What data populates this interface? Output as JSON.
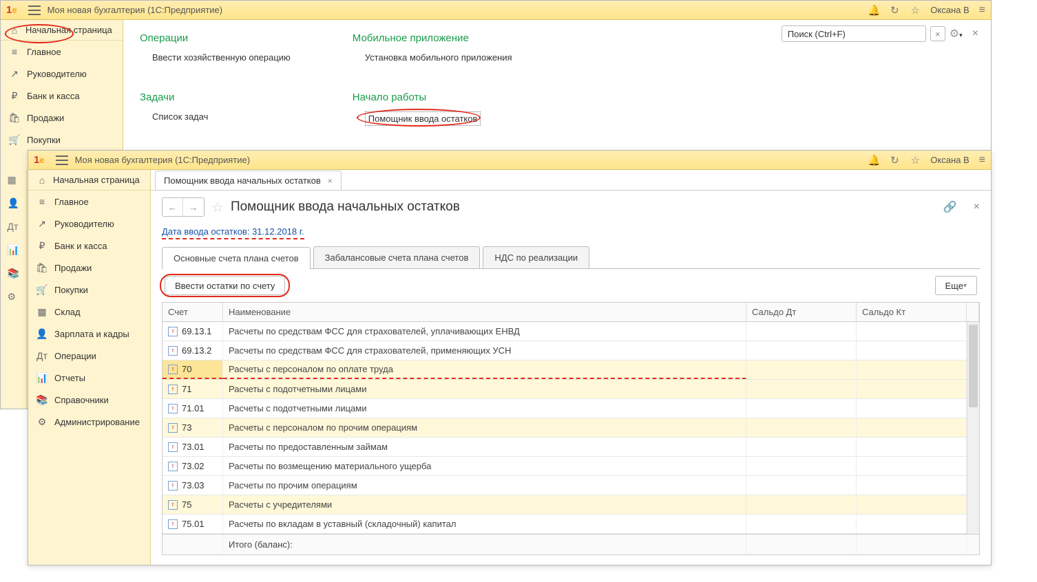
{
  "app_title": "Моя новая бухгалтерия  (1С:Предприятие)",
  "user": "Оксана В",
  "home_label": "Начальная страница",
  "sidebar": [
    {
      "icon": "≡",
      "label": "Главное"
    },
    {
      "icon": "↗",
      "label": "Руководителю"
    },
    {
      "icon": "₽",
      "label": "Банк и касса"
    },
    {
      "icon": "🛍",
      "label": "Продажи"
    },
    {
      "icon": "🛒",
      "label": "Покупки"
    },
    {
      "icon": "▦",
      "label": "Склад"
    },
    {
      "icon": "👤",
      "label": "Зарплата и кадры"
    },
    {
      "icon": "Дт",
      "label": "Операции"
    },
    {
      "icon": "📊",
      "label": "Отчеты"
    },
    {
      "icon": "📚",
      "label": "Справочники"
    },
    {
      "icon": "⚙",
      "label": "Администрирование"
    }
  ],
  "narrow_icons": [
    "▦",
    "👤",
    "Дт",
    "📊",
    "📚",
    "⚙"
  ],
  "sections": {
    "ops": {
      "title": "Операции",
      "link": "Ввести хозяйственную операцию"
    },
    "tasks": {
      "title": "Задачи",
      "link": "Список задач"
    },
    "mobile": {
      "title": "Мобильное приложение",
      "link": "Установка мобильного приложения"
    },
    "start": {
      "title": "Начало работы",
      "link": "Помощник ввода остатков"
    }
  },
  "search_placeholder": "Поиск (Ctrl+F)",
  "win2": {
    "tab_label": "Помощник ввода начальных остатков",
    "page_title": "Помощник ввода начальных остатков",
    "date_link": "Дата ввода остатков: 31.12.2018 г.",
    "subtabs": [
      "Основные счета плана счетов",
      "Забалансовые счета плана счетов",
      "НДС по реализации"
    ],
    "enter_btn": "Ввести остатки по счету",
    "more_btn": "Еще",
    "cols": {
      "acc": "Счет",
      "name": "Наименование",
      "dt": "Сальдо Дт",
      "kt": "Сальдо Кт"
    },
    "rows": [
      {
        "acc": "69.13.1",
        "name": "Расчеты по средствам ФСС для страхователей, уплачивающих ЕНВД",
        "hl": false
      },
      {
        "acc": "69.13.2",
        "name": "Расчеты по средствам ФСС для страхователей, применяющих УСН",
        "hl": false
      },
      {
        "acc": "70",
        "name": "Расчеты с персоналом по оплате труда",
        "hl": true,
        "sel": true
      },
      {
        "acc": "71",
        "name": "Расчеты с подотчетными лицами",
        "hl": true
      },
      {
        "acc": "71.01",
        "name": "Расчеты с подотчетными лицами",
        "hl": false
      },
      {
        "acc": "73",
        "name": "Расчеты с персоналом по прочим операциям",
        "hl": true
      },
      {
        "acc": "73.01",
        "name": "Расчеты по предоставленным займам",
        "hl": false
      },
      {
        "acc": "73.02",
        "name": "Расчеты по возмещению материального ущерба",
        "hl": false
      },
      {
        "acc": "73.03",
        "name": "Расчеты по прочим операциям",
        "hl": false
      },
      {
        "acc": "75",
        "name": "Расчеты с учредителями",
        "hl": true
      },
      {
        "acc": "75.01",
        "name": "Расчеты по вкладам в уставный (складочный) капитал",
        "hl": false
      }
    ],
    "footer": "Итого (баланс):"
  }
}
